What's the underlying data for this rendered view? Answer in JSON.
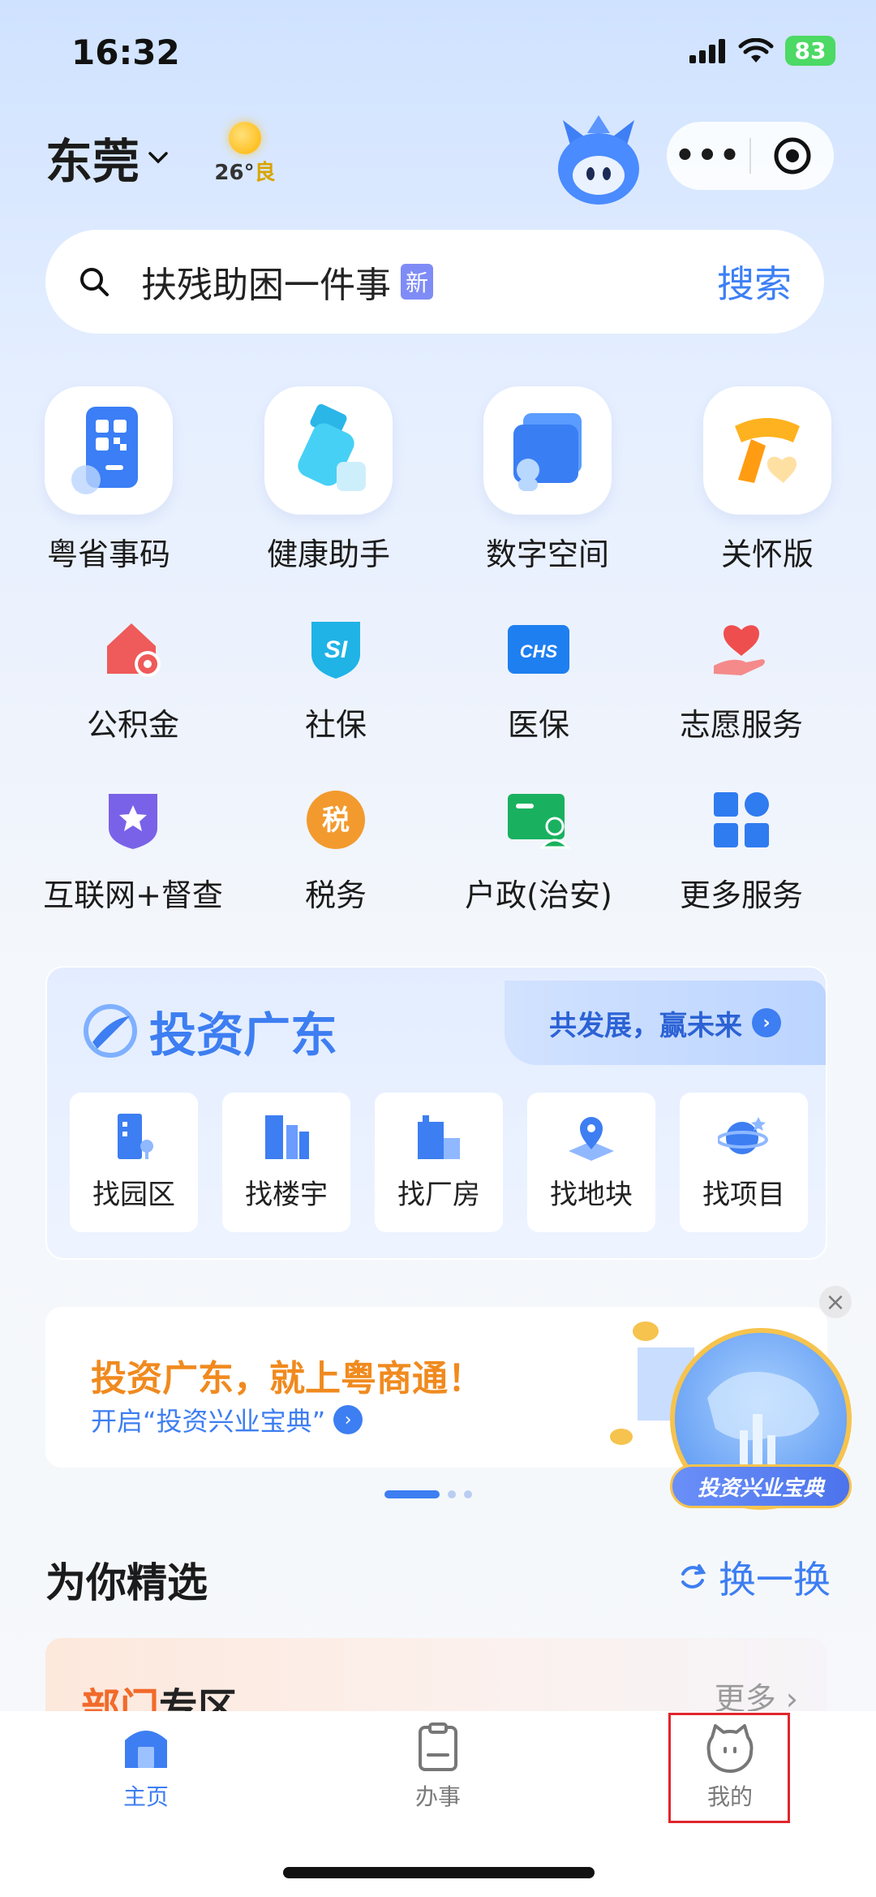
{
  "status": {
    "time": "16:32",
    "battery": "83"
  },
  "header": {
    "city": "东莞",
    "weather_temp": "26°",
    "weather_quality": "良"
  },
  "search": {
    "placeholder": "扶残助困一件事",
    "new_tag": "新",
    "button": "搜索"
  },
  "quick_apps": [
    {
      "label": "粤省事码",
      "icon": "qr-code-icon"
    },
    {
      "label": "健康助手",
      "icon": "health-assistant-icon"
    },
    {
      "label": "数字空间",
      "icon": "wallet-icon"
    },
    {
      "label": "关怀版",
      "icon": "scarf-heart-icon"
    }
  ],
  "services": [
    {
      "label": "公积金",
      "icon": "housing-fund-icon"
    },
    {
      "label": "社保",
      "icon": "social-security-icon",
      "icon_text": "SI"
    },
    {
      "label": "医保",
      "icon": "medical-insurance-icon",
      "icon_text": "CHS"
    },
    {
      "label": "志愿服务",
      "icon": "volunteer-heart-icon"
    },
    {
      "label": "互联网+督查",
      "icon": "star-shield-icon"
    },
    {
      "label": "税务",
      "icon": "tax-icon",
      "icon_text": "税"
    },
    {
      "label": "户政(治安)",
      "icon": "id-card-icon"
    },
    {
      "label": "更多服务",
      "icon": "grid-icon"
    }
  ],
  "invest": {
    "title": "投资广东",
    "slogan": "共发展，赢未来",
    "items": [
      {
        "label": "找园区",
        "icon": "park-building-icon"
      },
      {
        "label": "找楼宇",
        "icon": "office-building-icon"
      },
      {
        "label": "找厂房",
        "icon": "factory-icon"
      },
      {
        "label": "找地块",
        "icon": "land-pin-icon"
      },
      {
        "label": "找项目",
        "icon": "project-planet-icon"
      }
    ]
  },
  "banner": {
    "headline": "投资广东，就上粤商通！",
    "subline": "开启“投资兴业宝典”",
    "badge": "投资兴业宝典"
  },
  "featured": {
    "title": "为你精选",
    "refresh": "换一换",
    "dept_title_part1": "部门",
    "dept_title_part2": "专区",
    "more": "更多"
  },
  "tabbar": {
    "home": "主页",
    "tasks": "办事",
    "mine": "我的"
  },
  "colors": {
    "accent": "#3d7ef2",
    "orange": "#f08a1e",
    "highlight_box": "#e0262c"
  }
}
